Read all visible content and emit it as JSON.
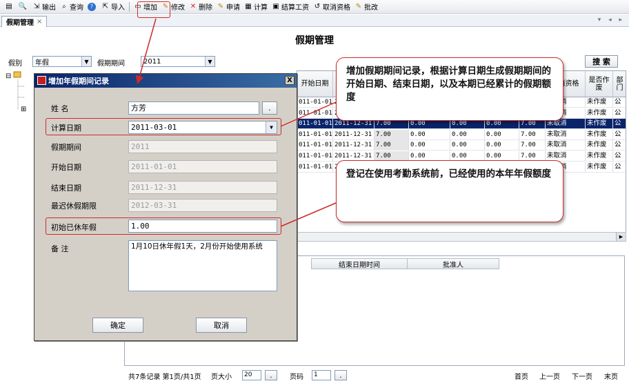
{
  "toolbar": {
    "items": [
      {
        "label": "",
        "icon": "print-icon"
      },
      {
        "label": "",
        "icon": "preview-icon"
      },
      {
        "label": "输出",
        "icon": "export-icon"
      },
      {
        "label": "查询",
        "icon": "search-icon"
      },
      {
        "label": "",
        "icon": "help-icon"
      },
      {
        "label": "导入",
        "icon": "import-icon"
      },
      {
        "label": "增加",
        "icon": "add-icon"
      },
      {
        "label": "修改",
        "icon": "edit-icon"
      },
      {
        "label": "删除",
        "icon": "delete-icon"
      },
      {
        "label": "申请",
        "icon": "apply-icon"
      },
      {
        "label": "计算",
        "icon": "calculate-icon"
      },
      {
        "label": "结算工资",
        "icon": "settle-icon"
      },
      {
        "label": "取消资格",
        "icon": "cancel-qualification-icon"
      },
      {
        "label": "批改",
        "icon": "batch-edit-icon"
      }
    ]
  },
  "tab": {
    "label": "假期管理",
    "close": "×",
    "arrows": "▾ ◂ ▸"
  },
  "page": {
    "title": "假期管理"
  },
  "filter": {
    "type_label": "假别",
    "type_value": "年假",
    "period_label": "假期期间",
    "period_value": "2011",
    "search_button": "搜 索"
  },
  "grid": {
    "headers": [
      "开始日期",
      "",
      "",
      "",
      "",
      "",
      "",
      "取消资格",
      "是否作废",
      "部门"
    ],
    "rows": [
      [
        "011-01-01",
        "2011-12-31",
        "7.00",
        "0.00",
        "0.00",
        "0.00",
        "7.00",
        "未取消",
        "未作废",
        "公"
      ],
      [
        "011-01-01",
        "2011-12-31",
        "7.00",
        "0.00",
        "0.00",
        "0.00",
        "7.00",
        "未取消",
        "未作废",
        "公"
      ],
      [
        "011-01-01",
        "2011-12-31",
        "7.00",
        "0.00",
        "0.00",
        "0.00",
        "7.00",
        "未取消",
        "未作废",
        "公"
      ],
      [
        "011-01-01",
        "2011-12-31",
        "7.00",
        "0.00",
        "0.00",
        "0.00",
        "7.00",
        "未取消",
        "未作废",
        "公"
      ],
      [
        "011-01-01",
        "2011-12-31",
        "7.00",
        "0.00",
        "0.00",
        "0.00",
        "7.00",
        "未取消",
        "未作废",
        "公"
      ],
      [
        "011-01-01",
        "2011-12-31",
        "7.00",
        "0.00",
        "0.00",
        "0.00",
        "7.00",
        "未取消",
        "未作废",
        "公"
      ],
      [
        "011-01-01",
        "2011-12-31",
        "7.00",
        "0.00",
        "0.00",
        "0.00",
        "7.00",
        "未取消",
        "未作废",
        "公"
      ]
    ],
    "selected_row": 2
  },
  "detail_grid": {
    "headers": [
      "结束日期时间",
      "批准人"
    ]
  },
  "pager": {
    "summary": "共7条记录  第1页/共1页",
    "page_size_label": "页大小",
    "page_size": "20",
    "page_label": "页码",
    "page": "1",
    "first": "首页",
    "prev": "上一页",
    "next": "下一页",
    "last": "末页"
  },
  "dialog": {
    "title": "增加年假期间记录",
    "close": "X",
    "name_label": "姓    名",
    "name_value": "方芳",
    "name_button": ".",
    "calc_date_label": "计算日期",
    "calc_date_value": "2011-03-01",
    "period_label": "假期期间",
    "period_value": "2011",
    "start_label": "开始日期",
    "start_value": "2011-01-01",
    "end_label": "结束日期",
    "end_value": "2011-12-31",
    "deadline_label": "最迟休假期限",
    "deadline_value": "2012-03-31",
    "initial_label": "初始已休年假",
    "initial_value": "1.00",
    "remark_label": "备    注",
    "remark_value": "1月10日休年假1天，2月份开始使用系统",
    "ok_button": "确定",
    "cancel_button": "取消"
  },
  "callouts": {
    "top": "增加假期期间记录，根据计算日期生成假期期间的开始日期、结束日期，以及本期已经累计的假期额度",
    "bottom": "登记在使用考勤系统前，已经使用的本年年假额度"
  },
  "colors": {
    "highlight": "#cc2b2b",
    "selected_row": "#0a246a",
    "dialog_title": "#0a246a"
  }
}
